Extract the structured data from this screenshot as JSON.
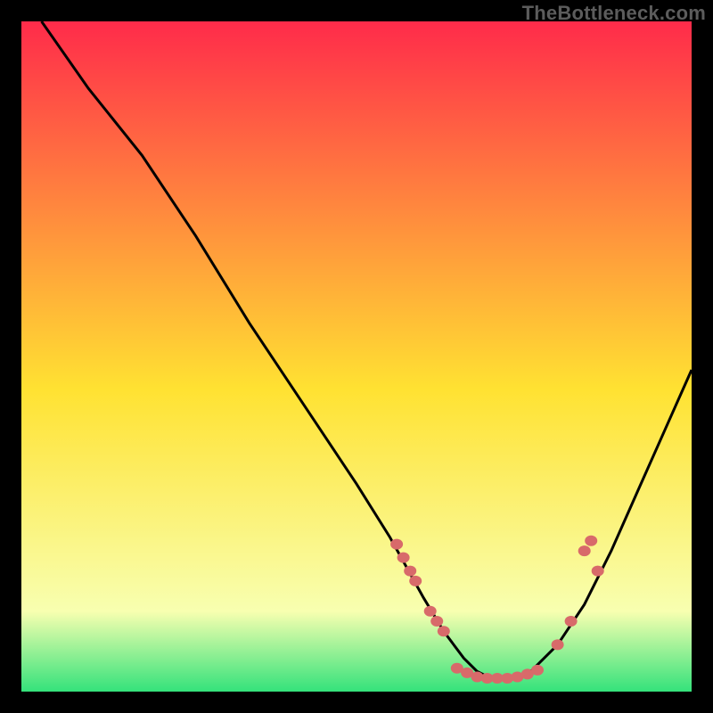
{
  "watermark": "TheBottleneck.com",
  "colors": {
    "gradient_top": "#ff2b4a",
    "gradient_mid": "#ffe232",
    "gradient_bottom": "#34e27b",
    "curve": "#000000",
    "marker": "#d86a6a"
  },
  "chart_data": {
    "type": "line",
    "title": "",
    "xlabel": "",
    "ylabel": "",
    "xlim": [
      0,
      100
    ],
    "ylim": [
      0,
      100
    ],
    "grid": false,
    "curve": {
      "x": [
        3,
        10,
        18,
        26,
        34,
        42,
        50,
        55,
        60,
        63,
        66,
        68,
        70,
        72,
        74,
        76,
        80,
        84,
        88,
        92,
        96,
        100
      ],
      "y": [
        100,
        90,
        80,
        68,
        55,
        43,
        31,
        23,
        14,
        9,
        5,
        3,
        2,
        2,
        2,
        3,
        7,
        13,
        21,
        30,
        39,
        48
      ]
    },
    "markers": [
      {
        "x": 56,
        "y": 22
      },
      {
        "x": 57,
        "y": 20
      },
      {
        "x": 58,
        "y": 18
      },
      {
        "x": 58.8,
        "y": 16.5
      },
      {
        "x": 61,
        "y": 12
      },
      {
        "x": 62,
        "y": 10.5
      },
      {
        "x": 63,
        "y": 9
      },
      {
        "x": 65,
        "y": 3.5
      },
      {
        "x": 66.5,
        "y": 2.8
      },
      {
        "x": 68,
        "y": 2.2
      },
      {
        "x": 69.5,
        "y": 2
      },
      {
        "x": 71,
        "y": 2
      },
      {
        "x": 72.5,
        "y": 2
      },
      {
        "x": 74,
        "y": 2.2
      },
      {
        "x": 75.5,
        "y": 2.6
      },
      {
        "x": 77,
        "y": 3.2
      },
      {
        "x": 80,
        "y": 7
      },
      {
        "x": 82,
        "y": 10.5
      },
      {
        "x": 84,
        "y": 21
      },
      {
        "x": 85,
        "y": 22.5
      },
      {
        "x": 86,
        "y": 18
      }
    ]
  }
}
